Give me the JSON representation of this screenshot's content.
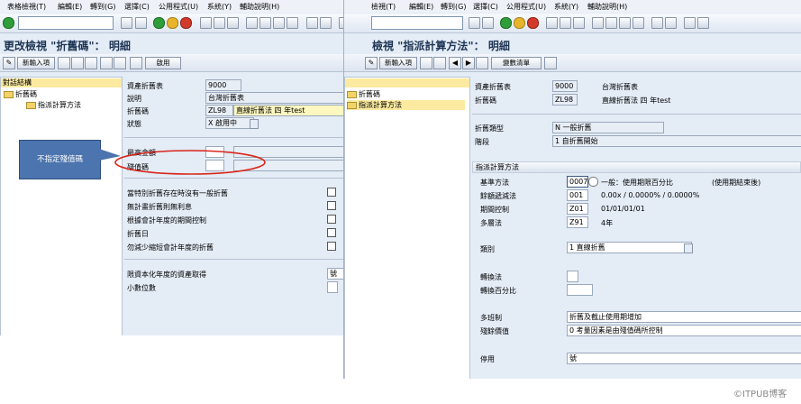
{
  "left": {
    "menu": [
      "表格檢視(T)",
      "編輯(E)",
      "轉到(G)",
      "選擇(C)",
      "公用程式(U)",
      "系統(Y)",
      "輔助說明(H)"
    ],
    "title": "更改檢視 \"折舊碼\"： 明細",
    "toolbar_buttons": [
      "新輸入項",
      "啟用"
    ],
    "tree": {
      "header": "對話結構",
      "items": [
        "折舊碼",
        "指派計算方法"
      ]
    },
    "form": {
      "chart_label": "資產折舊表",
      "chart_value": "9000",
      "desc_label": "說明",
      "desc_value": "台灣折舊表",
      "key_label": "折舊碼",
      "key_code": "ZL98",
      "key_text": "直線折舊法 四 年test",
      "status_label": "狀態",
      "status_value": "X 啟用中"
    },
    "fields": {
      "max_amount": "最高金額",
      "scrap_key": "殘值碼"
    },
    "checks": [
      "當特別折舊存在時沒有一般折舊",
      "無計畫折舊則無利息",
      "根據會計年度的期間控制",
      "折舊日",
      "勿減少縮短會計年度的折舊"
    ],
    "asset_acq_label": "限資本化年度的資產取得",
    "asset_acq_value": "號",
    "decimals_label": "小數位數",
    "callout": "不指定殘值碼"
  },
  "right": {
    "menu": [
      "檢視(T)",
      "編輯(E)",
      "轉到(G)",
      "選擇(C)",
      "公用程式(U)",
      "系統(Y)",
      "輔助說明(H)"
    ],
    "title": "檢視 \"指派計算方法\"： 明細",
    "toolbar_buttons": [
      "新輸入項",
      "變數清單"
    ],
    "tree": {
      "items": [
        "折舊碼",
        "指派計算方法"
      ]
    },
    "header_form": {
      "chart_label": "資產折舊表",
      "chart_value": "9000",
      "chart_text": "台灣折舊表",
      "key_label": "折舊碼",
      "key_value": "ZL98",
      "key_text": "直線折舊法 四 年test",
      "dep_type_label": "折舊類型",
      "dep_type_value": "N 一般折舊",
      "phase_label": "階段",
      "phase_value": "1 自折舊開始"
    },
    "method": {
      "section": "指派計算方法",
      "base_label": "基準方法",
      "base_value": "0007",
      "base_text": "一般：使用期限百分比",
      "base_note": "(使用期結束後)",
      "decl_label": "餘額遞減法",
      "decl_value": "001",
      "decl_text": "0.00x / 0.0000% / 0.0000%",
      "period_label": "期間控制",
      "period_value": "Z01",
      "period_text": "01/01/01/01",
      "multi_label": "多層法",
      "multi_value": "Z91",
      "multi_text": "4年",
      "class_label": "類別",
      "class_value": "1 直線折舊",
      "conv_label": "轉換法",
      "conv_pct_label": "轉換百分比",
      "multi_shift_label": "多班制",
      "multi_shift_value": "折舊及截止使用期增加",
      "scrap_label": "殘餘價值",
      "scrap_value": "0 考量因素是由殘值碼所控制",
      "stop_label": "停用",
      "stop_value": "號"
    }
  },
  "watermark": "©ITPUB博客"
}
